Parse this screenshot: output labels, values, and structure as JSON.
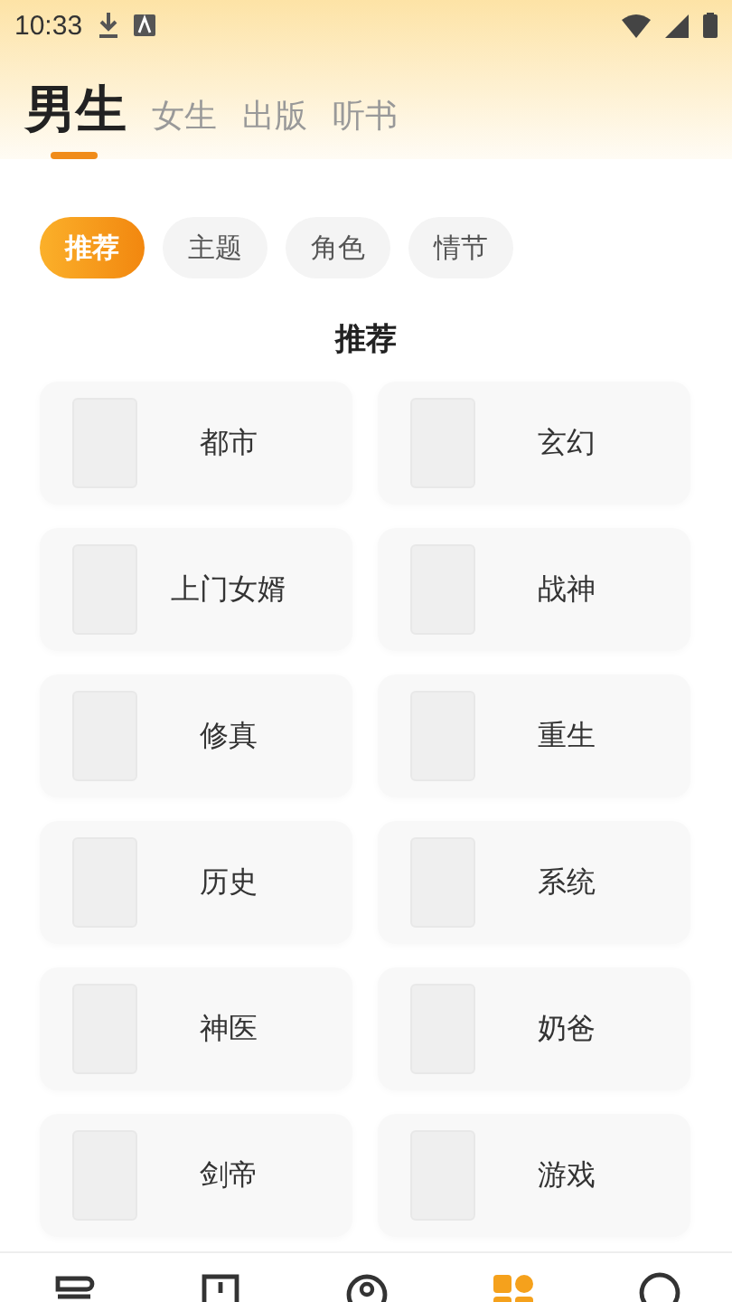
{
  "status_bar": {
    "time": "10:33"
  },
  "tabs": [
    {
      "label": "男生",
      "selected": true
    },
    {
      "label": "女生",
      "selected": false
    },
    {
      "label": "出版",
      "selected": false
    },
    {
      "label": "听书",
      "selected": false
    }
  ],
  "chips": [
    {
      "label": "推荐",
      "selected": true
    },
    {
      "label": "主题",
      "selected": false
    },
    {
      "label": "角色",
      "selected": false
    },
    {
      "label": "情节",
      "selected": false
    }
  ],
  "section_title": "推荐",
  "categories": [
    {
      "label": "都市"
    },
    {
      "label": "玄幻"
    },
    {
      "label": "上门女婿"
    },
    {
      "label": "战神"
    },
    {
      "label": "修真"
    },
    {
      "label": "重生"
    },
    {
      "label": "历史"
    },
    {
      "label": "系统"
    },
    {
      "label": "神医"
    },
    {
      "label": "奶爸"
    },
    {
      "label": "剑帝"
    },
    {
      "label": "游戏"
    }
  ],
  "bottom_nav": [
    {
      "kind": "shelf",
      "selected": false
    },
    {
      "kind": "book",
      "selected": false
    },
    {
      "kind": "discover",
      "selected": false
    },
    {
      "kind": "category",
      "selected": true
    },
    {
      "kind": "profile",
      "selected": false
    }
  ]
}
